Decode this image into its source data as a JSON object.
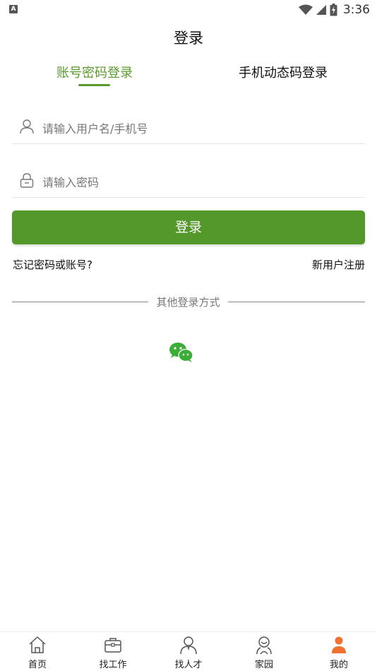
{
  "status_bar": {
    "time": "3:36",
    "notification_letter": "A"
  },
  "page": {
    "title": "登录"
  },
  "tabs": [
    {
      "label": "账号密码登录",
      "active": true
    },
    {
      "label": "手机动态码登录",
      "active": false
    }
  ],
  "form": {
    "username_placeholder": "请输入用户名/手机号",
    "password_placeholder": "请输入密码",
    "login_label": "登录",
    "forgot_label": "忘记密码或账号?",
    "register_label": "新用户注册"
  },
  "other_login": {
    "label": "其他登录方式",
    "icon": "wechat-icon"
  },
  "bottom_nav": [
    {
      "label": "首页",
      "icon": "home-icon",
      "active": false
    },
    {
      "label": "找工作",
      "icon": "briefcase-icon",
      "active": false
    },
    {
      "label": "找人才",
      "icon": "person-icon",
      "active": false
    },
    {
      "label": "家园",
      "icon": "community-icon",
      "active": false
    },
    {
      "label": "我的",
      "icon": "profile-icon",
      "active": true
    }
  ],
  "colors": {
    "accent": "#54982c",
    "active_nav": "#f07030",
    "wechat": "#3cae38"
  }
}
